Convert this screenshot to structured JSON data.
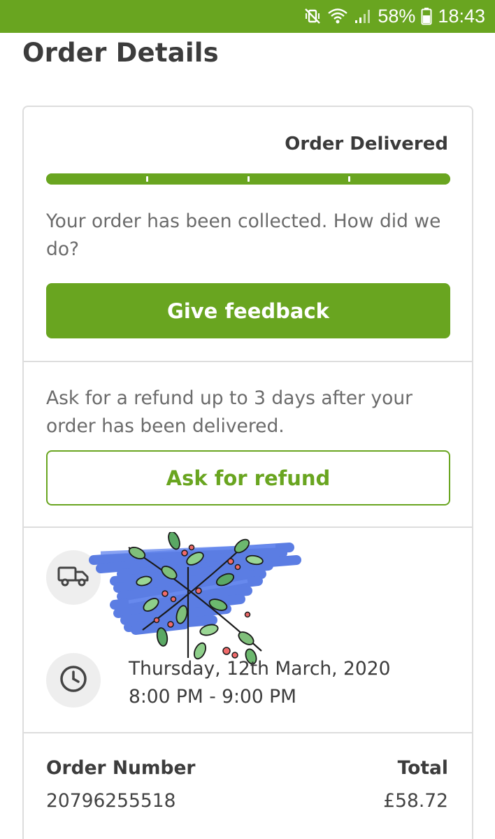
{
  "status_bar": {
    "battery_percent": "58%",
    "time": "18:43",
    "icons": [
      "vibrate-mute-icon",
      "wifi-icon",
      "signal-icon",
      "battery-icon"
    ]
  },
  "page": {
    "title": "Order Details"
  },
  "order_status": {
    "label": "Order Delivered",
    "progress_fraction": 1.0,
    "message": "Your order has been collected. How did we do?",
    "feedback_button_label": "Give feedback"
  },
  "refund": {
    "message": "Ask for a refund up to 3 days after your order has been delivered.",
    "button_label": "Ask for refund"
  },
  "delivery": {
    "icon": "truck-icon",
    "address_redacted": true,
    "slot_icon": "clock-icon",
    "date": "Thursday, 12th March, 2020",
    "time": "8:00 PM - 9:00 PM"
  },
  "summary": {
    "order_number_label": "Order Number",
    "order_number": "20796255518",
    "total_label": "Total",
    "total": "£58.72"
  },
  "colors": {
    "brand_green": "#69a520",
    "redaction_blue": "#4a6fe0"
  }
}
